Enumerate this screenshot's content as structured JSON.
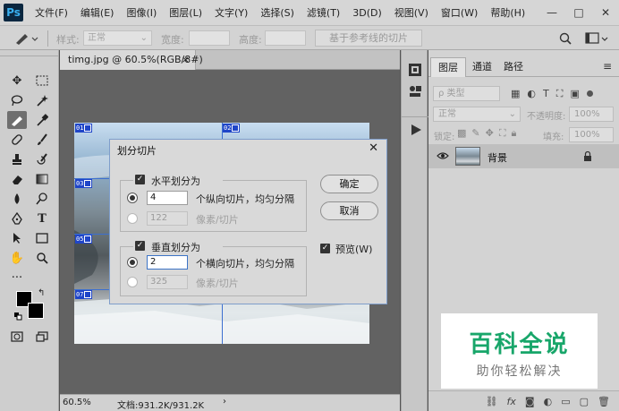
{
  "menu": {
    "logo": "Ps",
    "items": [
      "文件(F)",
      "编辑(E)",
      "图像(I)",
      "图层(L)",
      "文字(Y)",
      "选择(S)",
      "滤镜(T)",
      "3D(D)",
      "视图(V)",
      "窗口(W)",
      "帮助(H)"
    ],
    "window_buttons": [
      "—",
      "□",
      "✕"
    ]
  },
  "options": {
    "style_label": "样式:",
    "style_value": "正常",
    "width_label": "宽度:",
    "height_label": "高度:",
    "guides_button": "基于参考线的切片"
  },
  "document": {
    "tab_title": "timg.jpg @ 60.5%(RGB/8#)",
    "tab_close": "×",
    "zoom": "60.5%",
    "doc_info": "文档:931.2K/931.2K",
    "slice_labels": [
      "01",
      "02",
      "03",
      "05",
      "07"
    ]
  },
  "dialog": {
    "title": "划分切片",
    "close": "✕",
    "horizontal": {
      "label": "水平划分为",
      "count": "4",
      "count_suffix": "个纵向切片，均匀分隔",
      "pixels": "122",
      "pixels_suffix": "像素/切片"
    },
    "vertical": {
      "label": "垂直划分为",
      "count": "2",
      "count_suffix": "个横向切片，均匀分隔",
      "pixels": "325",
      "pixels_suffix": "像素/切片"
    },
    "ok": "确定",
    "cancel": "取消",
    "preview": "预览(W)"
  },
  "layers_panel": {
    "tabs": [
      "图层",
      "通道",
      "路径"
    ],
    "filter_kind": "ρ 类型",
    "blend_mode": "正常",
    "opacity_label": "不透明度:",
    "opacity_value": "100%",
    "lock_label": "锁定:",
    "fill_label": "填充:",
    "fill_value": "100%",
    "layer_name": "背景"
  },
  "watermark": {
    "main": "百科全说",
    "sub": "助你轻松解决"
  }
}
